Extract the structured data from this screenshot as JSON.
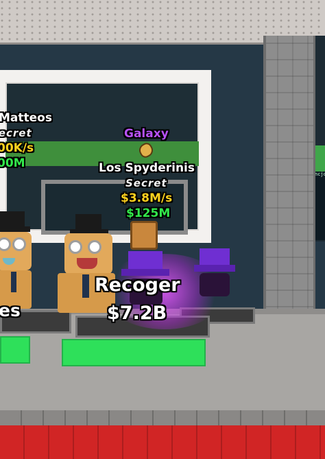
{
  "left_pet": {
    "name": "Matteos",
    "rarity": "Secret",
    "income": "00K/s",
    "price": "00M",
    "platform_label": "es"
  },
  "center_pet": {
    "mutation": "Galaxy",
    "name": "Los Spyderinis",
    "rarity": "Secret",
    "income": "$3.8M/s",
    "price": "$125M"
  },
  "platform_pet": {
    "name": "Recoger",
    "price": "$7.2B"
  },
  "side_chat": {
    "snippet": "ncjo"
  },
  "colors": {
    "mutation_purple": "#b651f5",
    "income_yellow": "#ffd21e",
    "price_green": "#32e84b",
    "pad_green": "#2ee05a",
    "floor_red": "#d12525"
  },
  "icons": {
    "mutation_icon": "corn-icon"
  }
}
